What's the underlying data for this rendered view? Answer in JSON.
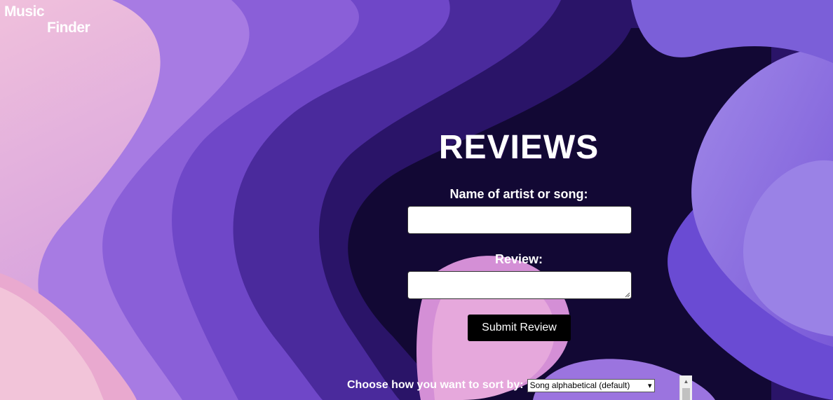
{
  "logo": {
    "line1": "Music",
    "line2": "Finder"
  },
  "page": {
    "title": "REVIEWS"
  },
  "form": {
    "name_label": "Name of artist or song:",
    "name_value": "",
    "review_label": "Review:",
    "review_value": "",
    "submit_label": "Submit Review"
  },
  "sort": {
    "label": "Choose how you want to sort by:",
    "selected": "Song alphabetical (default)"
  },
  "colors": {
    "accent_dark": "#120834",
    "accent_purple": "#6b4fd6",
    "accent_pink": "#e8a6d8",
    "button_bg": "#000000",
    "text": "#ffffff"
  },
  "icons": {
    "sort_dropdown": "chevron-down-icon",
    "scroll_up": "scroll-up-arrow-icon"
  }
}
